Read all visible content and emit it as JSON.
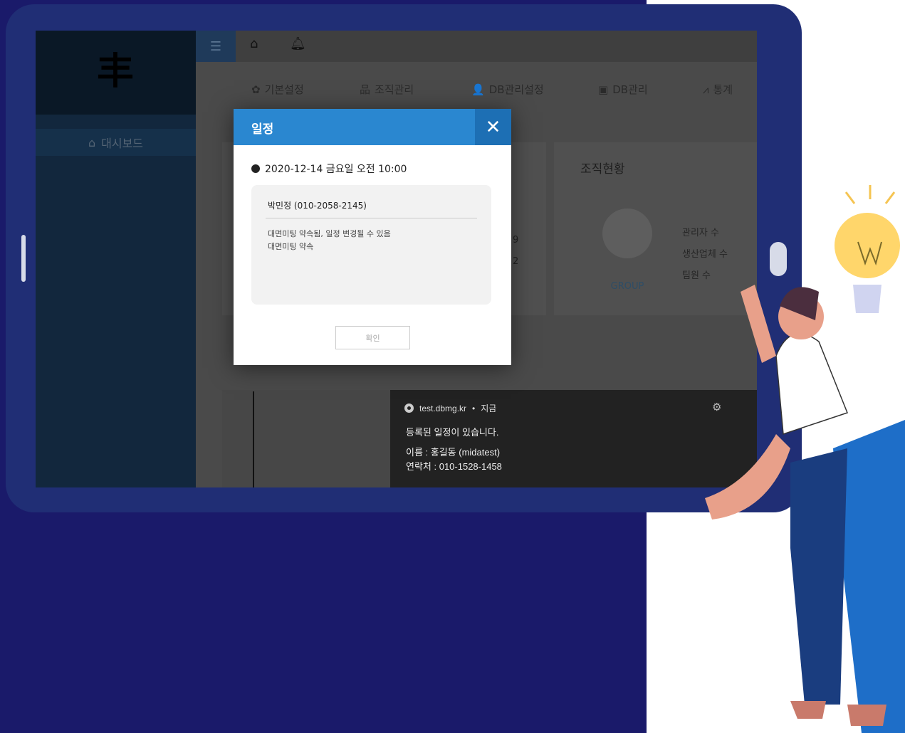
{
  "sidebar": {
    "logo_text": "丰",
    "dashboard_icon": "dashboard-icon",
    "dashboard_label": "대시보드"
  },
  "topbar": {
    "menu_icon": "hamburger-icon",
    "home_icon": "home-icon",
    "bell_icon": "bell-icon"
  },
  "menu": [
    {
      "icon": "gear-icon",
      "glyph": "✿",
      "label": "기본설정"
    },
    {
      "icon": "sitemap-icon",
      "glyph": "品",
      "label": "조직관리"
    },
    {
      "icon": "user-cog-icon",
      "glyph": "👤",
      "label": "DB관리설정"
    },
    {
      "icon": "id-card-icon",
      "glyph": "▣",
      "label": "DB관리"
    },
    {
      "icon": "chart-line-icon",
      "glyph": "⩘",
      "label": "통계"
    }
  ],
  "org_status": {
    "title": "조직현황",
    "group_label": "GROUP",
    "stats": [
      "관리자 수",
      "생산업체 수",
      "팀원 수"
    ],
    "partial_values": [
      "9",
      "2"
    ]
  },
  "modal": {
    "title": "일정",
    "close_label": "X",
    "date": "2020-12-14 금요일 오전 10:00",
    "name_line": "박민정 (010-2058-2145)",
    "memo_line1": "대면미팅 약속됨, 일정 변경될 수 있음",
    "memo_line2": "대면미팅 약속",
    "confirm_label": "확인"
  },
  "notification": {
    "source": "test.dbmg.kr",
    "separator": "•",
    "time": "지금",
    "title": "등록된 일정이 있습니다.",
    "line1": "이름 : 홍길동 (midatest)",
    "line2": "연락처 : 010-1528-1458"
  },
  "colors": {
    "page_bg": "#1a1a6a",
    "tablet_frame": "#202e75",
    "modal_header": "#2a87d0",
    "modal_close": "#1d6fb4"
  }
}
